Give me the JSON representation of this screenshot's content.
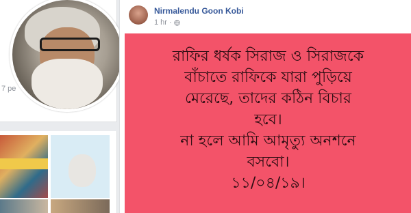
{
  "post": {
    "author": "Nirmalendu Goon Kobi",
    "time": "1 hr",
    "privacy_icon": "globe-icon",
    "background_color": "#f35369",
    "text_lines": [
      "রাফির ধর্ষক সিরাজ ও সিরাজকে",
      "বাঁচাতে রাফিকে যারা পুড়িয়ে",
      "মেরেছে, তাদের কঠিন বিচার",
      "হবে।",
      "না হলে আমি আমৃত্যু অনশনে",
      "বসবো।",
      "১১/০৪/১৯।"
    ]
  },
  "sidebar": {
    "partial_text_top": "",
    "partial_text_bottom": "7 pe"
  }
}
